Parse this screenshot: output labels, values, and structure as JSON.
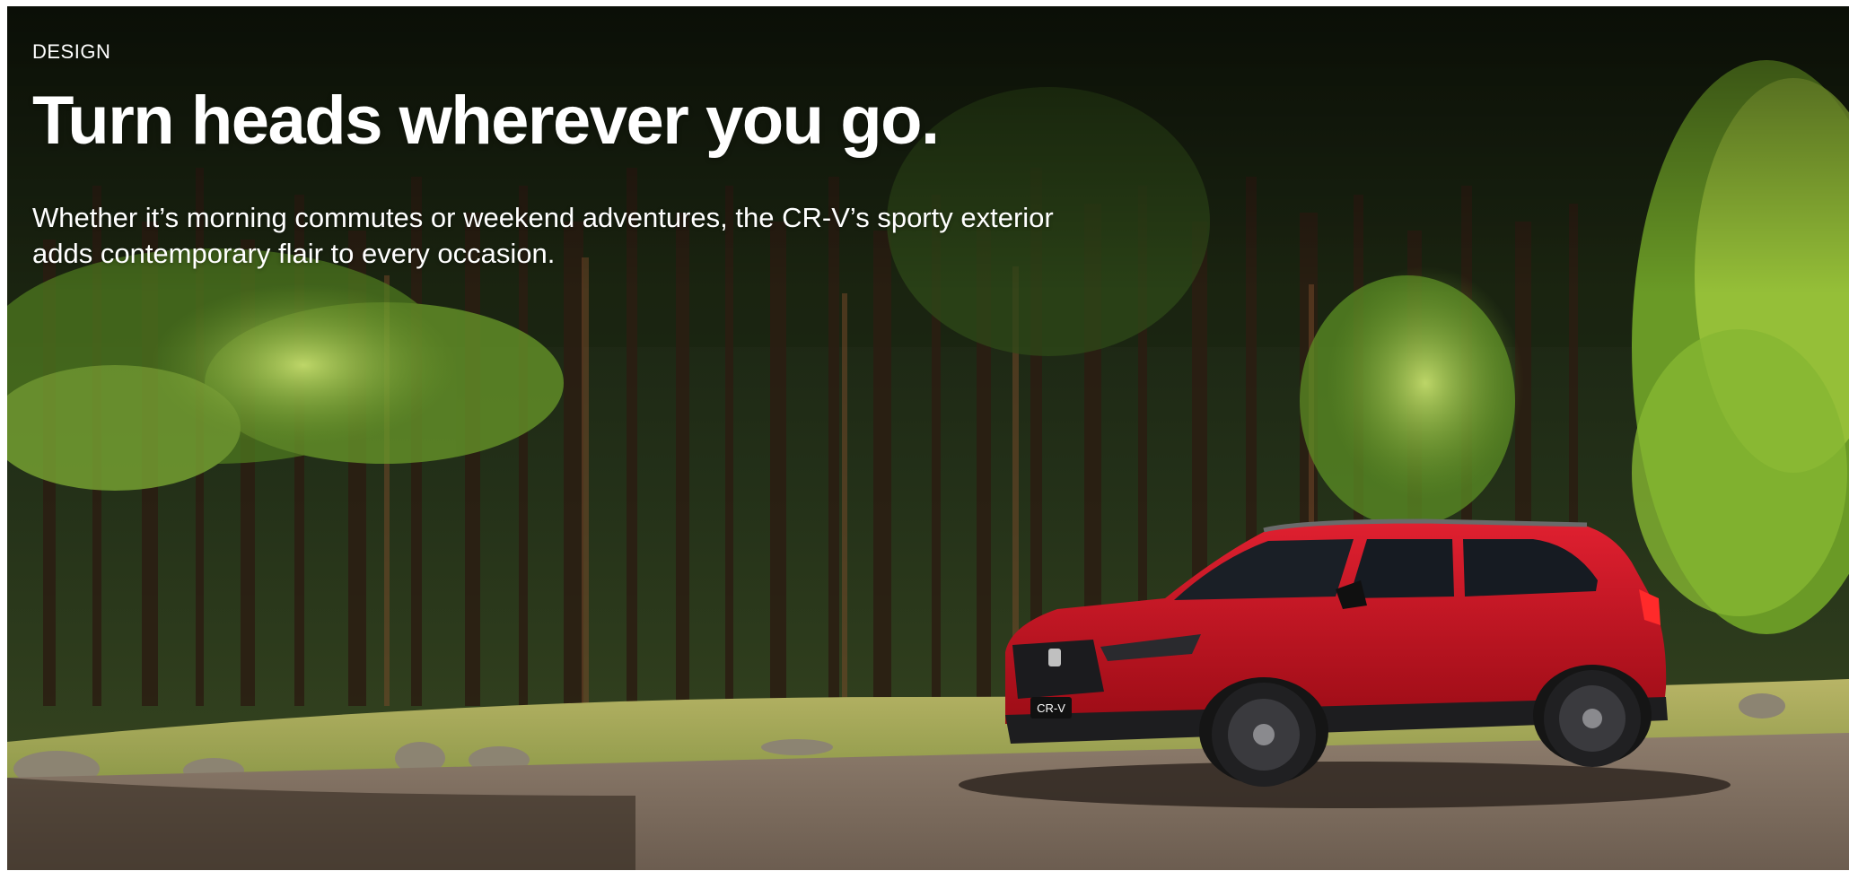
{
  "section": {
    "eyebrow": "DESIGN",
    "headline": "Turn heads wherever you go.",
    "body": "Whether it’s morning commutes or weekend adventures, the CR-V’s sporty exterior adds contemporary flair to every occasion."
  },
  "image": {
    "badge_text": "CR-V",
    "colors": {
      "car_red": "#c8101e",
      "forest_dark": "#1b2412",
      "foliage_light": "#8fbf3a",
      "gravel": "#8a7a6b"
    }
  }
}
